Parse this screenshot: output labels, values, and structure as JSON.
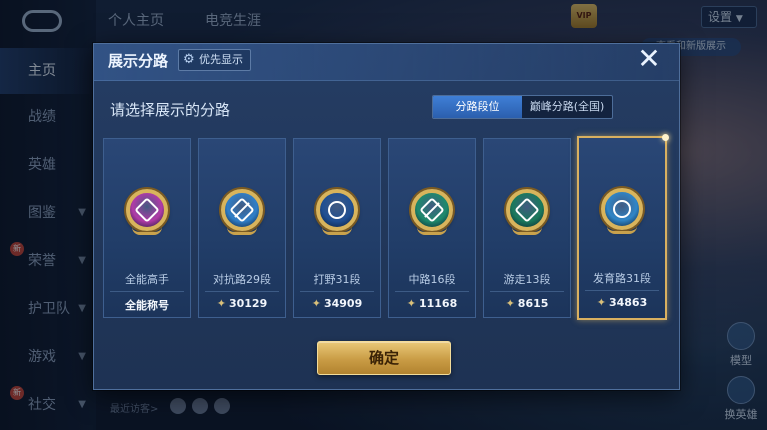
{
  "background": {
    "top_tabs": [
      "个人主页",
      "电竞生涯"
    ],
    "settings_label": "设置",
    "vip_label": "VIP",
    "side_chip": "查看和新版展示",
    "nav_items": [
      {
        "label": "主页",
        "active": true,
        "chevron": false,
        "badge": ""
      },
      {
        "label": "战绩",
        "active": false,
        "chevron": false,
        "badge": ""
      },
      {
        "label": "英雄",
        "active": false,
        "chevron": false,
        "badge": ""
      },
      {
        "label": "图鉴",
        "active": false,
        "chevron": true,
        "badge": ""
      },
      {
        "label": "荣誉",
        "active": false,
        "chevron": true,
        "badge": "新"
      },
      {
        "label": "护卫队",
        "active": false,
        "chevron": true,
        "badge": ""
      },
      {
        "label": "游戏",
        "active": false,
        "chevron": true,
        "badge": ""
      },
      {
        "label": "社交",
        "active": false,
        "chevron": true,
        "badge": "新"
      }
    ],
    "recent_visitors": "最近访客>",
    "bottom_right": [
      {
        "label": "模型"
      },
      {
        "label": "换英雄"
      }
    ]
  },
  "dialog": {
    "title": "展示分路",
    "priority_label": "优先显示",
    "close_symbol": "✕",
    "subtitle": "请选择展示的分路",
    "toggle": {
      "selected": "分路段位",
      "other": "巅峰分路(全国)"
    },
    "cards": [
      {
        "name": "全能高手",
        "score": "全能称号",
        "emblem_color": "#b13aa8",
        "icon": "all-round-emblem-icon",
        "glyph": "diamond",
        "selected": false,
        "lane_mark": ""
      },
      {
        "name": "对抗路29段",
        "score": "30129",
        "emblem_color": "#2f7fc9",
        "icon": "clash-lane-emblem-icon",
        "glyph": "slash",
        "selected": false,
        "lane_mark": "✦"
      },
      {
        "name": "打野31段",
        "score": "34909",
        "emblem_color": "#1f4f93",
        "icon": "jungle-emblem-icon",
        "glyph": "circle",
        "selected": false,
        "lane_mark": "✦"
      },
      {
        "name": "中路16段",
        "score": "11168",
        "emblem_color": "#1e8a6c",
        "icon": "mid-lane-emblem-icon",
        "glyph": "slash",
        "selected": false,
        "lane_mark": "✦"
      },
      {
        "name": "游走13段",
        "score": "8615",
        "emblem_color": "#1a7a5c",
        "icon": "roam-emblem-icon",
        "glyph": "diamond",
        "selected": false,
        "lane_mark": "✦"
      },
      {
        "name": "发育路31段",
        "score": "34863",
        "emblem_color": "#2f86c8",
        "icon": "farm-lane-emblem-icon",
        "glyph": "circle",
        "selected": true,
        "lane_mark": "✦"
      }
    ],
    "confirm_label": "确定"
  }
}
